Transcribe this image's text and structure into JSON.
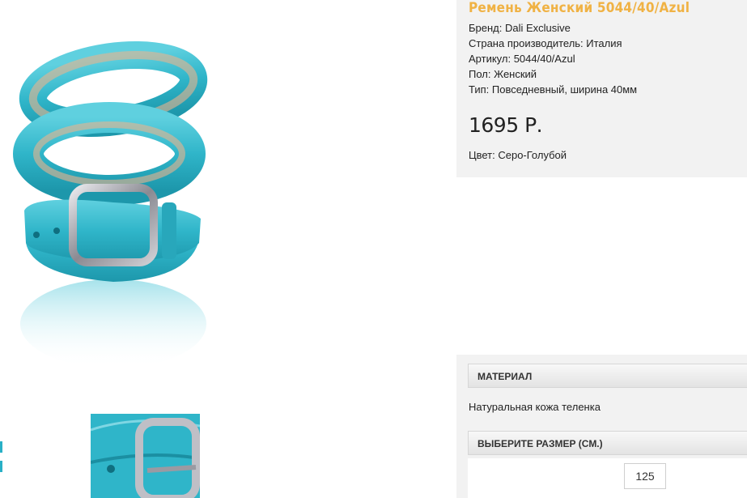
{
  "product": {
    "title": "Ремень Женский 5044/40/Azul",
    "specs": [
      "Бренд: Dali Exclusive",
      "Страна производитель: Италия",
      "Артикул: 5044/40/Azul",
      "Пол: Женский",
      "Тип: Повседневный, ширина 40мм"
    ],
    "price": "1695 Р.",
    "color": "Цвет: Серо-Голубой"
  },
  "material": {
    "header": "МАТЕРИАЛ",
    "text": "Натуральная кожа теленка"
  },
  "size": {
    "header": "ВЫБЕРИТЕ РАЗМЕР (СМ.)",
    "options": [
      "125"
    ]
  },
  "colors": {
    "accent_title": "#f0b244",
    "belt": "#2fb5c9",
    "panel_bg": "#f2f2f2"
  }
}
